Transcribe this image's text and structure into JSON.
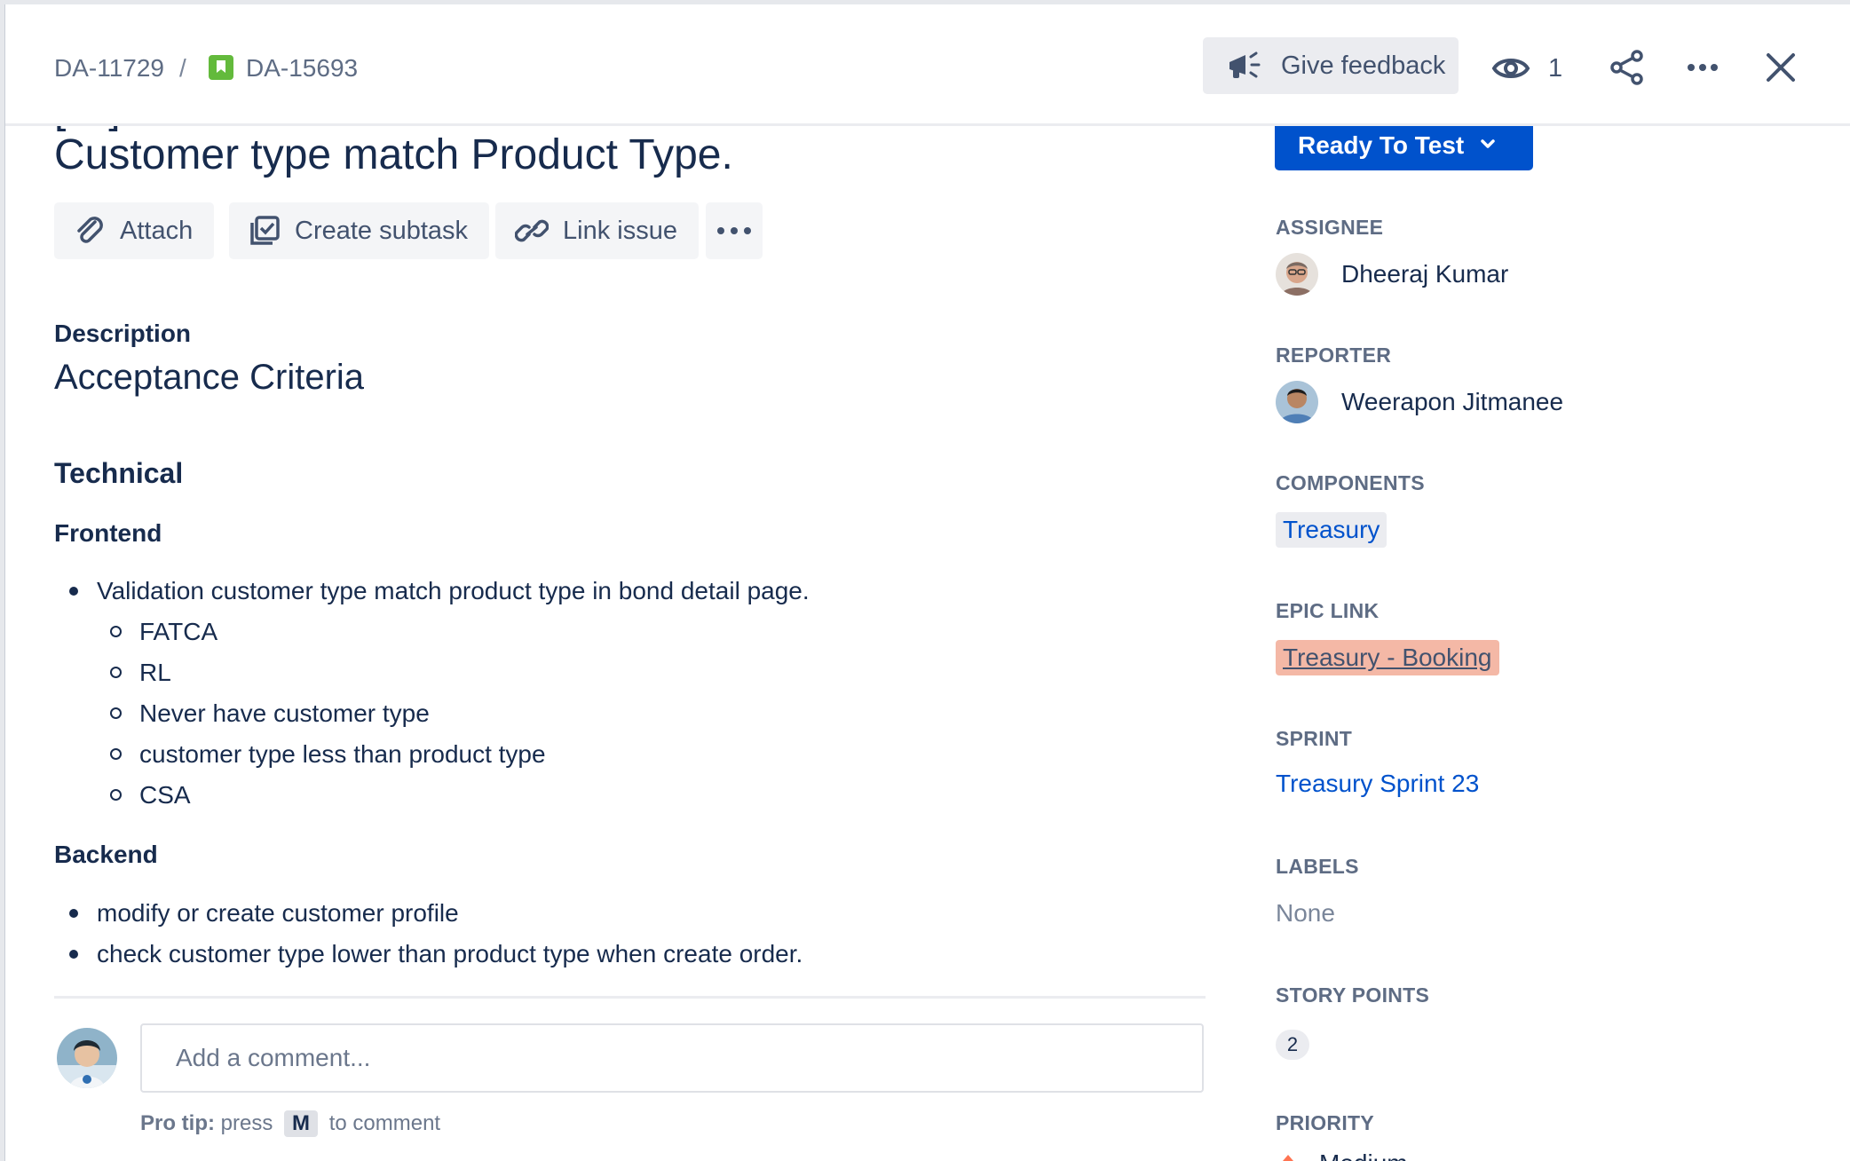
{
  "header": {
    "parent_key": "DA-11729",
    "separator": "/",
    "issue_key": "DA-15693",
    "feedback_label": "Give feedback",
    "watch_count": "1"
  },
  "issue": {
    "title_partial_above": "[---] ---- ---- -----  ---- ---- ---- ---- -----",
    "title_line": "Customer type match Product Type."
  },
  "actions": {
    "attach": "Attach",
    "create_subtask": "Create subtask",
    "link_issue": "Link issue"
  },
  "description": {
    "label": "Description",
    "heading": "Acceptance Criteria",
    "technical": "Technical",
    "frontend": "Frontend",
    "frontend_item": "Validation customer type match product type in bond detail page.",
    "frontend_subitems": [
      "FATCA",
      "RL",
      "Never have customer type",
      "customer type less than product type",
      "CSA"
    ],
    "backend": "Backend",
    "backend_items": [
      "modify or create customer profile",
      "check customer type lower than product type when create order."
    ]
  },
  "comment": {
    "placeholder": "Add a comment...",
    "protip_bold": "Pro tip:",
    "protip_pre": "press",
    "protip_key": "M",
    "protip_post": "to comment"
  },
  "sidebar": {
    "status": "Ready To Test",
    "assignee_label": "ASSIGNEE",
    "assignee": "Dheeraj Kumar",
    "reporter_label": "REPORTER",
    "reporter": "Weerapon Jitmanee",
    "components_label": "COMPONENTS",
    "component": "Treasury",
    "epic_label": "EPIC LINK",
    "epic": "Treasury - Booking",
    "sprint_label": "SPRINT",
    "sprint": "Treasury Sprint 23",
    "labels_label": "LABELS",
    "labels_value": "None",
    "story_points_label": "STORY POINTS",
    "story_points": "2",
    "priority_label": "PRIORITY",
    "priority": "Medium"
  },
  "colors": {
    "primary": "#0052cc",
    "epic": "#f4b8a6",
    "story_icon": "#63ba3c"
  }
}
